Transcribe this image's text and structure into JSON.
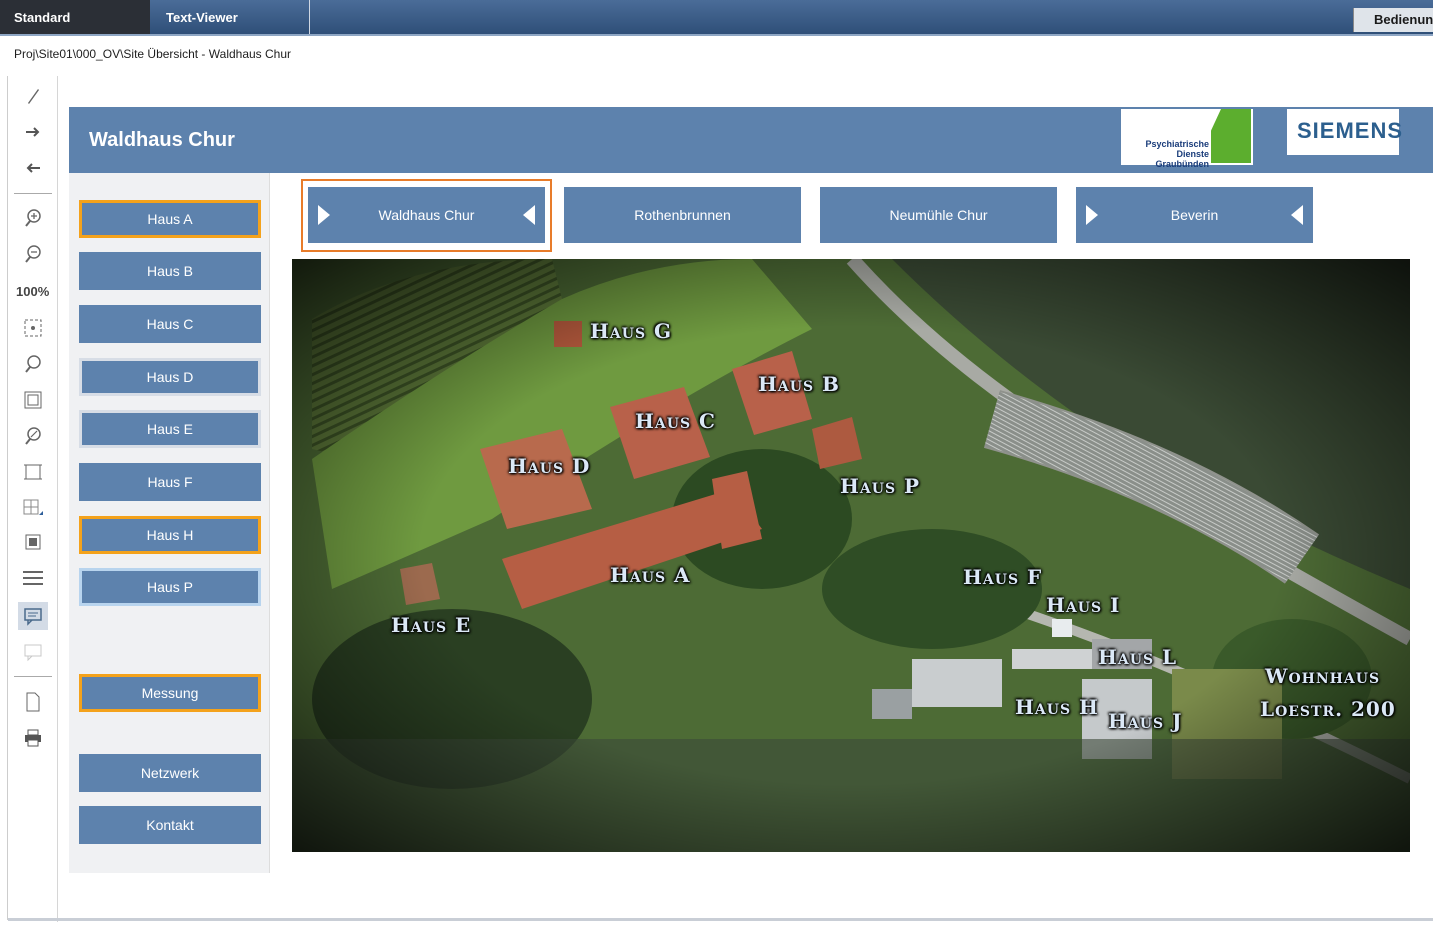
{
  "topbar": {
    "tab_standard": "Standard",
    "tab_textviewer": "Text-Viewer",
    "tab_bedienung": "Bedienung"
  },
  "breadcrumb": "Proj\\Site01\\000_OV\\Site Übersicht  -  Waldhaus Chur",
  "toolbar": {
    "zoom": "100%"
  },
  "header": {
    "title": "Waldhaus Chur",
    "logo_pdgr_line1": "Psychiatrische",
    "logo_pdgr_line2": "Dienste Graubünden",
    "logo_siemens": "SIEMENS"
  },
  "nav": {
    "haus_a": "Haus A",
    "haus_b": "Haus B",
    "haus_c": "Haus C",
    "haus_d": "Haus D",
    "haus_e": "Haus E",
    "haus_f": "Haus F",
    "haus_h": "Haus H",
    "haus_p": "Haus P",
    "messung": "Messung",
    "netzwerk": "Netzwerk",
    "kontakt": "Kontakt"
  },
  "sites": {
    "waldhaus": "Waldhaus Chur",
    "rothenbrunnen": "Rothenbrunnen",
    "neumuehle": "Neumühle Chur",
    "beverin": "Beverin"
  },
  "map_labels": {
    "haus_g": "Haus G",
    "haus_b": "Haus B",
    "haus_c": "Haus C",
    "haus_d": "Haus D",
    "haus_p": "Haus P",
    "haus_a": "Haus A",
    "haus_f": "Haus F",
    "haus_e": "Haus E",
    "haus_i": "Haus I",
    "haus_l": "Haus L",
    "haus_h": "Haus H",
    "haus_j": "Haus J",
    "wohnhaus_1": "Wohnhaus",
    "wohnhaus_2": "Loestr. 200"
  },
  "colors": {
    "accent_blue": "#5d82ad",
    "highlight_orange": "#f4a21b"
  }
}
